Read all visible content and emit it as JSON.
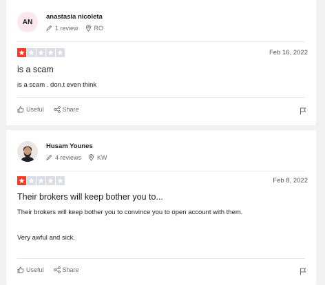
{
  "reviews": [
    {
      "avatar_initials": "AN",
      "author": "anastasia nicoleta",
      "review_count": "1 review",
      "country": "RO",
      "rating": 1,
      "date": "Feb 16, 2022",
      "title": "is a scam",
      "body": "is a scam . don.t even think",
      "useful_label": "Useful",
      "share_label": "Share"
    },
    {
      "avatar_initials": "",
      "author": "Husam Younes",
      "review_count": "4 reviews",
      "country": "KW",
      "rating": 1,
      "date": "Feb 8, 2022",
      "title": "Their brokers will keep bother you to...",
      "body": "Their brokers will keep bother you to convince you to open account with them.\n\n\nVery awful and sick.",
      "useful_label": "Useful",
      "share_label": "Share"
    }
  ],
  "colors": {
    "star_on": "#ff3722",
    "star_off": "#dcdce6",
    "avatar_bg": "#fde7ef"
  }
}
